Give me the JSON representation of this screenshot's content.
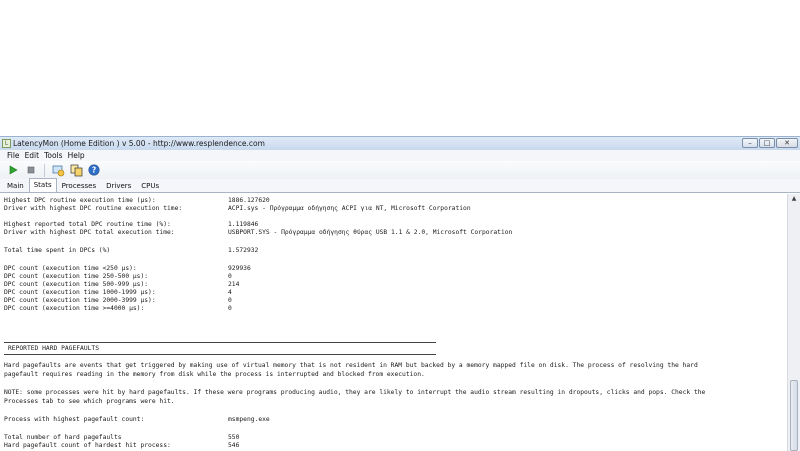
{
  "window": {
    "title": "LatencyMon  (Home Edition )  v 5.00 - http://www.resplendence.com",
    "icon_text": "L",
    "controls": {
      "minimize": "–",
      "maximize": "□",
      "close": "✕"
    }
  },
  "menu": [
    "File",
    "Edit",
    "Tools",
    "Help"
  ],
  "toolbar": {
    "icons": [
      "play-icon",
      "stop-icon",
      "process-icon",
      "copy-icon",
      "help-icon"
    ],
    "help_glyph": "?"
  },
  "tabs": [
    "Main",
    "Stats",
    "Processes",
    "Drivers",
    "CPUs"
  ],
  "active_tab": "Stats",
  "dpc_rows": [
    {
      "label": "Highest DPC routine execution time (µs):",
      "value": "1886.127620"
    },
    {
      "label": "Driver with highest DPC routine execution time:",
      "value": "ACPI.sys - Πρόγραμμα οδήγησης ACPI για NT, Microsoft Corporation"
    },
    {
      "label": "Highest reported total DPC routine time (%):",
      "value": "1.119846"
    },
    {
      "label": "Driver with highest DPC total execution time:",
      "value": "USBPORT.SYS - Πρόγραμμα οδήγησης θύρας USB 1.1 & 2.0, Microsoft Corporation"
    },
    {
      "label": "Total time spent in DPCs (%)",
      "value": "1.572932"
    },
    {
      "label": "DPC count (execution time <250 µs):",
      "value": "929936"
    },
    {
      "label": "DPC count (execution time 250-500 µs):",
      "value": "0"
    },
    {
      "label": "DPC count (execution time 500-999 µs):",
      "value": "214"
    },
    {
      "label": "DPC count (execution time 1000-1999 µs):",
      "value": "4"
    },
    {
      "label": "DPC count (execution time 2000-3999 µs):",
      "value": "0"
    },
    {
      "label": "DPC count (execution time >=4000 µs):",
      "value": "0"
    }
  ],
  "pagefault_section": {
    "heading": "REPORTED HARD PAGEFAULTS",
    "description_line1": "Hard pagefaults are events that get triggered by making use of virtual memory that is not resident in RAM but backed by a memory mapped file on disk. The process of resolving the hard",
    "description_line2": "pagefault requires reading in the memory from disk while the process is interrupted and blocked from execution.",
    "note_line1": "NOTE: some processes were hit by hard pagefaults. If these were programs producing audio, they are likely to interrupt the audio stream resulting in dropouts, clicks and pops. Check the",
    "note_line2": "Processes tab to see which programs were hit.",
    "rows": [
      {
        "label": "Process with highest pagefault count:",
        "value": "msmpeng.exe"
      },
      {
        "label": "Total number of hard pagefaults",
        "value": "550"
      },
      {
        "label": "Hard pagefault count of hardest hit process:",
        "value": "546"
      }
    ]
  }
}
